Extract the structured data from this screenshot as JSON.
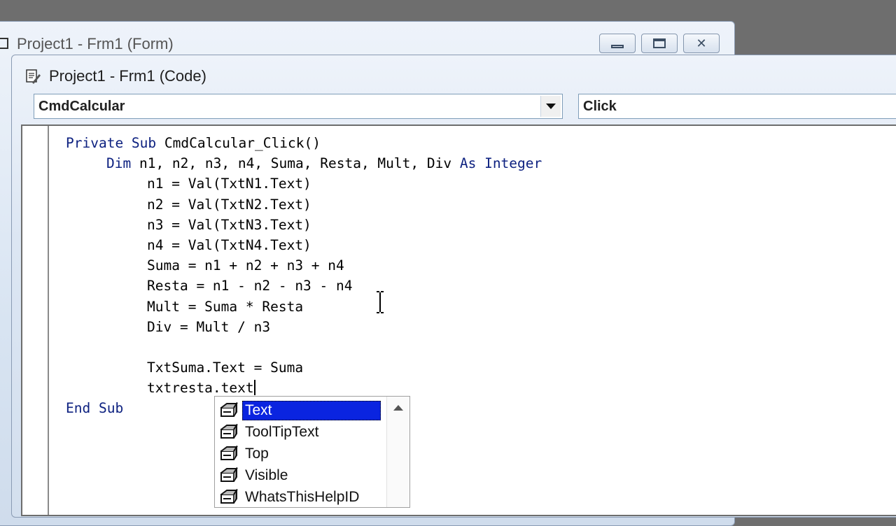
{
  "back_window": {
    "title": "Project1 - Frm1 (Form)"
  },
  "front_window": {
    "title": "Project1 - Frm1 (Code)"
  },
  "object_combo": {
    "value": "CmdCalcular"
  },
  "procedure_combo": {
    "value": "Click"
  },
  "code_lines": [
    "Private Sub CmdCalcular_Click()",
    "Dim n1, n2, n3, n4, Suma, Resta, Mult, Div As Integer",
    "n1 = Val(TxtN1.Text)",
    "n2 = Val(TxtN2.Text)",
    "n3 = Val(TxtN3.Text)",
    "n4 = Val(TxtN4.Text)",
    "Suma = n1 + n2 + n3 + n4",
    "Resta = n1 - n2 - n3 - n4",
    "Mult = Suma * Resta",
    "Div = Mult / n3",
    "",
    "TxtSuma.Text = Suma",
    "txtresta.text",
    "End Sub"
  ],
  "autocomplete": {
    "items": [
      "Text",
      "ToolTipText",
      "Top",
      "Visible",
      "WhatsThisHelpID"
    ],
    "selected": "Text"
  },
  "colors": {
    "keyword": "#0d2180",
    "selection": "#0a24e0"
  }
}
